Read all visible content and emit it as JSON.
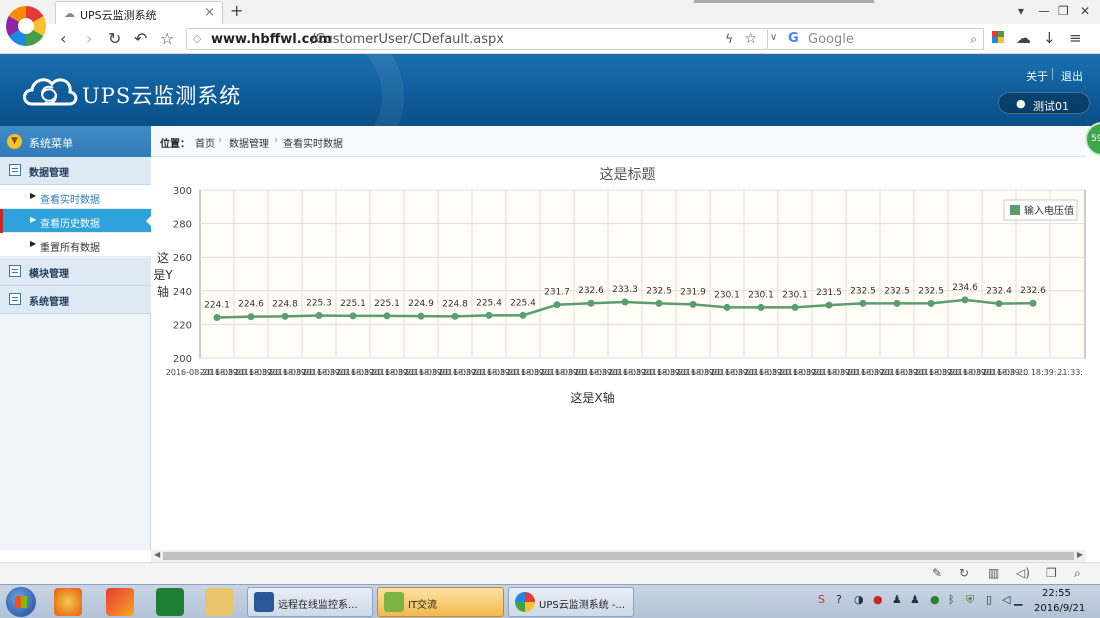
{
  "browser": {
    "tab_title": "UPS云监测系统",
    "url_host": "www.hbffwl.com",
    "url_path": "/CustomerUser/CDefault.aspx",
    "search_placeholder": "Google"
  },
  "header": {
    "app_title": "UPS云监测系统",
    "about": "关于",
    "logout": "退出",
    "user": "测试01"
  },
  "sidebar": {
    "title": "系统菜单",
    "groups": [
      {
        "label": "数据管理",
        "items": [
          "查看实时数据",
          "查看历史数据",
          "重置所有数据"
        ]
      },
      {
        "label": "模块管理"
      },
      {
        "label": "系统管理"
      }
    ],
    "active_item": "查看历史数据"
  },
  "breadcrumb": {
    "label": "位置：",
    "items": [
      "首页",
      "数据管理",
      "查看实时数据"
    ]
  },
  "badge": "59",
  "chart_data": {
    "type": "line",
    "title": "这是标题",
    "xlabel": "这是X轴",
    "ylabel": "这是Y轴",
    "ylim": [
      200,
      300
    ],
    "yticks": [
      200,
      220,
      240,
      260,
      280,
      300
    ],
    "grid": true,
    "legend_position": "top-right",
    "x_tick_text": "2016-08-20 18:39:...",
    "x_tick_last": "21:33:",
    "series": [
      {
        "name": "输入电压值",
        "color": "#5a9e6f",
        "values": [
          224.1,
          224.6,
          224.8,
          225.3,
          225.1,
          225.1,
          224.9,
          224.8,
          225.4,
          225.4,
          231.7,
          232.6,
          233.3,
          232.5,
          231.9,
          230.1,
          230.1,
          230.1,
          231.5,
          232.5,
          232.5,
          232.5,
          234.6,
          232.4,
          232.6
        ]
      }
    ]
  },
  "taskbar": {
    "tasks": [
      "远程在线监控系...",
      "IT交流",
      "UPS云监测系统 -..."
    ],
    "time": "22:55",
    "date": "2016/9/21"
  }
}
